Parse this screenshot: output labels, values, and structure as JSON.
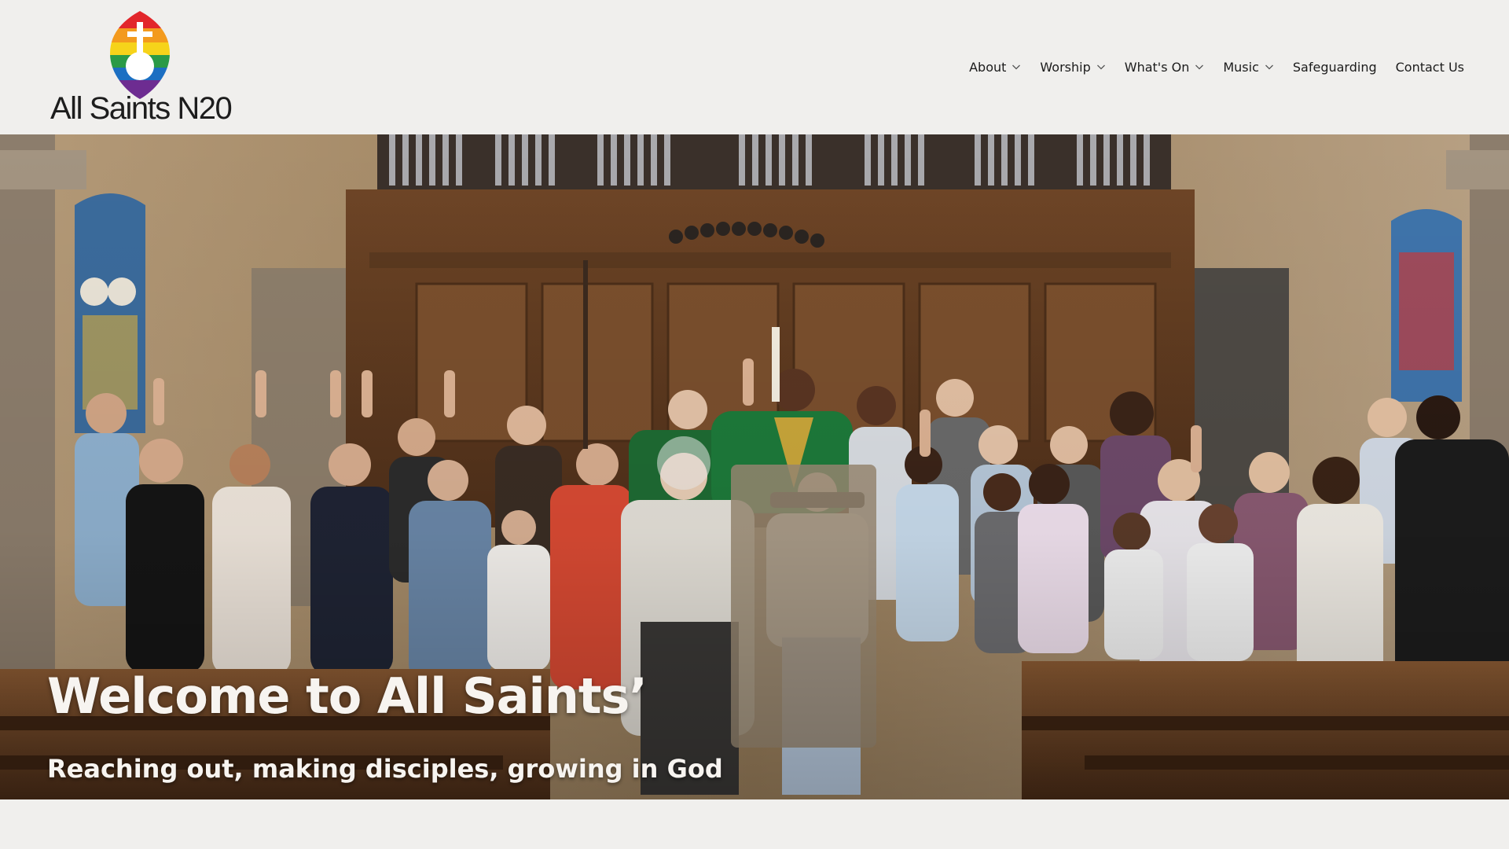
{
  "site": {
    "logo_text": "All Saints N20",
    "logo_icon": "rainbow-shield-cross-logo"
  },
  "nav": {
    "items": [
      {
        "label": "About",
        "has_dropdown": true
      },
      {
        "label": "Worship",
        "has_dropdown": true
      },
      {
        "label": "What's On",
        "has_dropdown": true
      },
      {
        "label": "Music",
        "has_dropdown": true
      },
      {
        "label": "Safeguarding",
        "has_dropdown": false
      },
      {
        "label": "Contact Us",
        "has_dropdown": false
      }
    ]
  },
  "hero": {
    "title": "Welcome to All Saints’",
    "subtitle": "Reaching out, making disciples, growing in God",
    "image": "congregation-group-photo"
  },
  "colors": {
    "background": "#f0efed",
    "text": "#1b1b1b",
    "hero_text": "#f7f4f0",
    "wood": "#6b4528"
  }
}
